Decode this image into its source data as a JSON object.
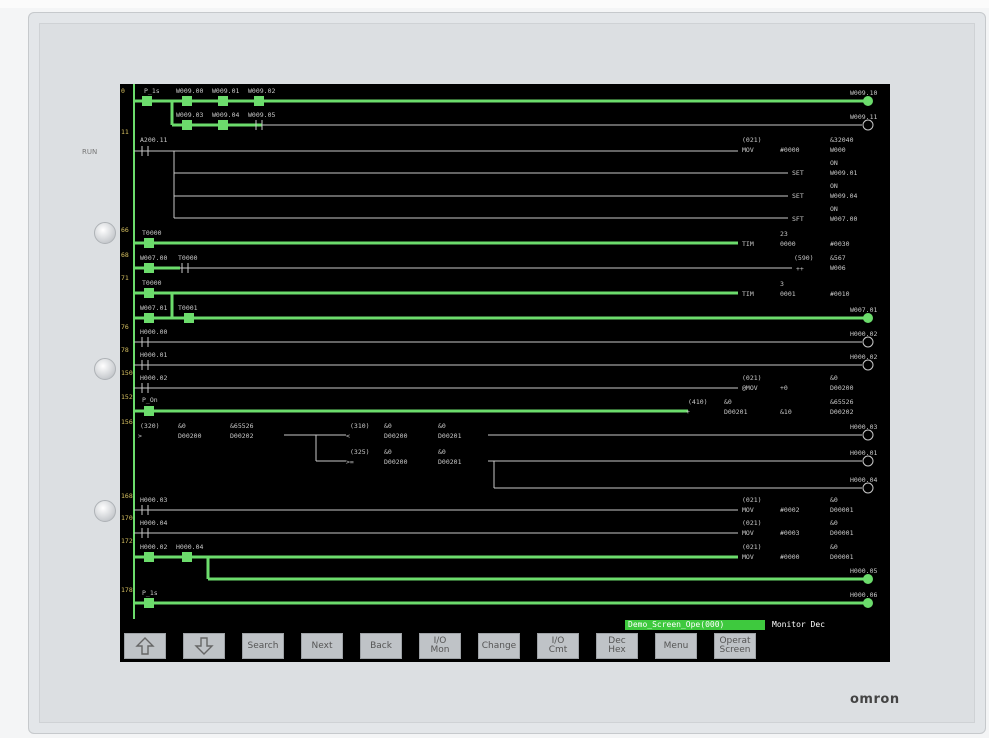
{
  "brand": "omron",
  "panel": {
    "run_label": "RUN"
  },
  "status_bar": {
    "program": "Demo_Screen_Ope(000)",
    "mode": "Monitor Dec"
  },
  "function_keys": [
    {
      "icon": "arrow-up-icon"
    },
    {
      "icon": "arrow-down-icon"
    },
    {
      "label": "Search"
    },
    {
      "label": "Next"
    },
    {
      "label": "Back"
    },
    {
      "label": "I/O\nMon"
    },
    {
      "label": "Change"
    },
    {
      "label": "I/O\nCmt"
    },
    {
      "label": "Dec\nHex"
    },
    {
      "label": "Menu"
    },
    {
      "label": "Operat\nScreen"
    }
  ],
  "ladder": {
    "step_numbers": [
      "0",
      "11",
      "66",
      "68",
      "71",
      "76",
      "78",
      "150",
      "152",
      "156",
      "168",
      "170",
      "172",
      "178"
    ],
    "contacts": {
      "r0": [
        "P_1s",
        "W009.00",
        "W009.01",
        "W009.02"
      ],
      "r0b": [
        "W009.03",
        "W009.04",
        "W009.05"
      ],
      "r11": "A200.11",
      "r66": "T0000",
      "r68a": "W007.00",
      "r68b": "T0000",
      "r71a": "T0000",
      "r71b": "W007.01",
      "r71c": "T0001",
      "r76": "H000.00",
      "r78": "H000.01",
      "r150": "H000.02",
      "r152": "P_On",
      "r168": "H000.03",
      "r170": "H000.04",
      "r172a": "H000.02",
      "r172b": "H000.04",
      "r178": "P_1s"
    },
    "coils": [
      "W009.10",
      "W009.11",
      "W007.01",
      "H000.02",
      "H000.03",
      "H000.01",
      "H000.04",
      "H000.05",
      "H000.06"
    ],
    "instructions": {
      "mov1": {
        "fn": "(021)",
        "name": "MOV",
        "src": "#0000",
        "dst_top": "&32040",
        "dst": "W000"
      },
      "set1": {
        "name": "SET",
        "dst_top": "ON",
        "dst": "W009.01"
      },
      "set2": {
        "name": "SET",
        "dst_top": "ON",
        "dst": "W009.04"
      },
      "sft": {
        "name": "SFT",
        "dst_top": "ON",
        "dst": "W007.00"
      },
      "tim1": {
        "name": "TIM",
        "n_top": "23",
        "n": "0000",
        "sv": "#0030"
      },
      "inc": {
        "fn": "(590)",
        "name": "++",
        "dst_top": "&567",
        "dst": "W006"
      },
      "tim2": {
        "name": "TIM",
        "n_top": "3",
        "n": "0001",
        "sv": "#0010"
      },
      "mov2": {
        "fn": "(021)",
        "name": "@MOV",
        "src": "+0",
        "dst_top": "&0",
        "dst": "D00200"
      },
      "add": {
        "fn": "(410)",
        "name": "+",
        "a_top": "&0",
        "a": "D00201",
        "b": "&10",
        "dst_top": "&65526",
        "dst": "D00202"
      },
      "cmp1": {
        "fn": "(320)",
        "name": ">",
        "a_top": "&0",
        "a": "D00200",
        "b_top": "&65526",
        "b": "D00202"
      },
      "cmp2": {
        "fn": "(310)",
        "name": "<",
        "a_top": "&0",
        "a": "D00200",
        "b_top": "&0",
        "b": "D00201"
      },
      "cmp3": {
        "fn": "(325)",
        "name": ">=",
        "a_top": "&0",
        "a": "D00200",
        "b_top": "&0",
        "b": "D00201"
      },
      "mov3": {
        "fn": "(021)",
        "name": "MOV",
        "src": "#0002",
        "dst_top": "&0",
        "dst": "D00001"
      },
      "mov4": {
        "fn": "(021)",
        "name": "MOV",
        "src": "#0003",
        "dst_top": "&0",
        "dst": "D00001"
      },
      "mov5": {
        "fn": "(021)",
        "name": "MOV",
        "src": "#0000",
        "dst_top": "&0",
        "dst": "D00001"
      }
    }
  },
  "colors": {
    "active": "#6cdc6c",
    "inactive": "#c8c8c8",
    "screen_bg": "#000000",
    "status_green": "#3ec93e"
  }
}
